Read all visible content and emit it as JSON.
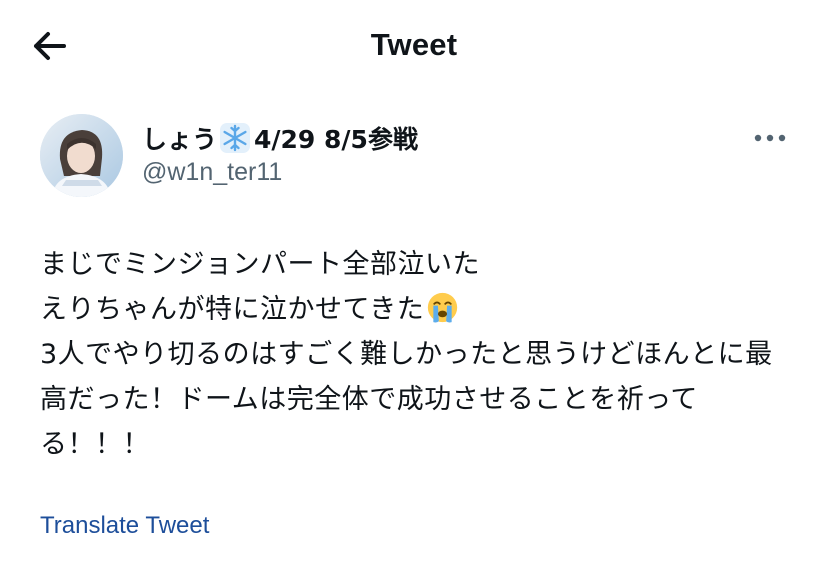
{
  "header": {
    "title": "Tweet",
    "back_icon": "arrow-left-icon"
  },
  "author": {
    "display_name": "しょう",
    "name_emoji": "snowflake-icon",
    "name_suffix": "4/29 8/5参戦",
    "handle": "@w1n_ter11"
  },
  "tweet": {
    "lines_before_emoji": "まじでミンジョンパート全部泣いた\nえりちゃんが特に泣かせてきた",
    "emoji": "loudly-crying-face-icon",
    "lines_after_emoji": "\n3人でやり切るのはすごく難しかったと思うけどほんとに最高だった！ドームは完全体で成功させることを祈ってる！！！"
  },
  "actions": {
    "translate_label": "Translate Tweet",
    "more_icon": "more-options-icon"
  },
  "colors": {
    "text": "#0f1419",
    "secondary_text": "#536471",
    "link": "#1d4e9a",
    "background": "#ffffff"
  }
}
